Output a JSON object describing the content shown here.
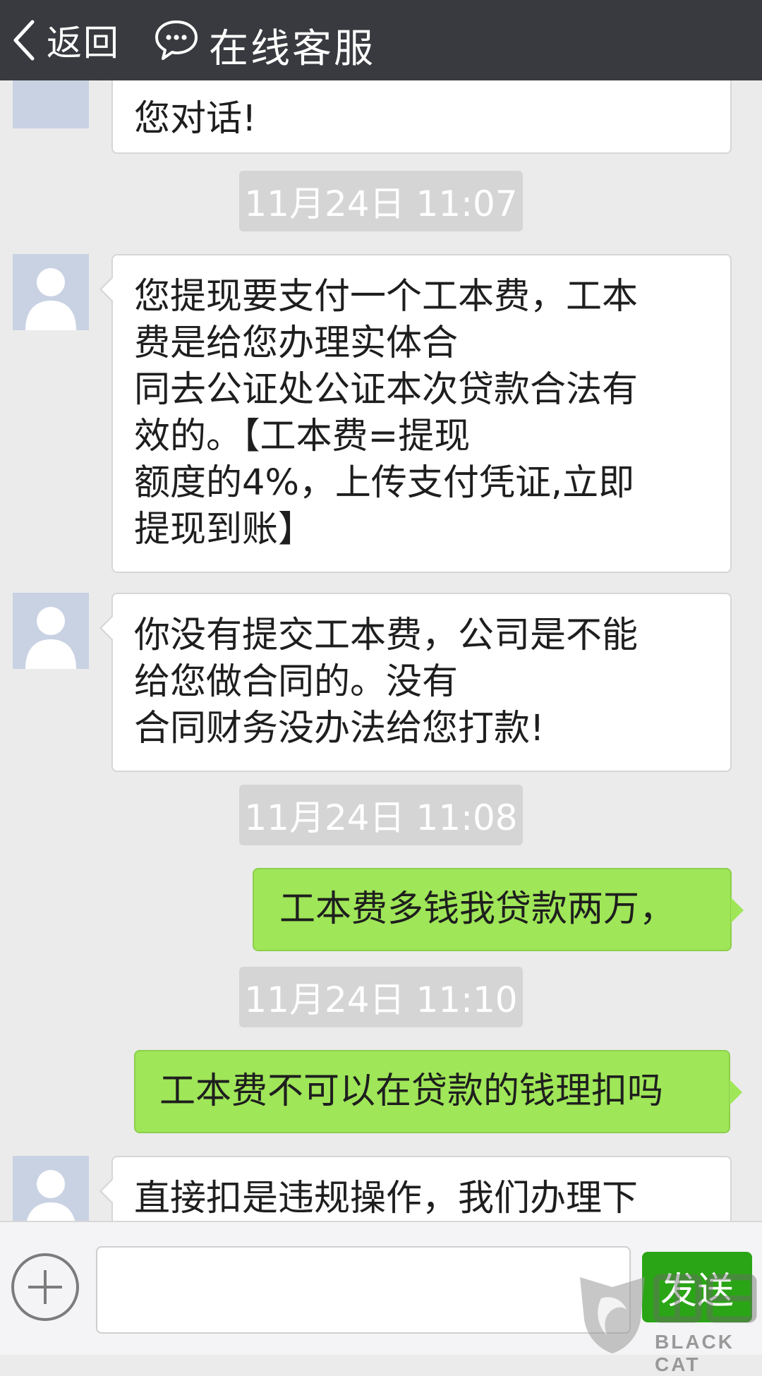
{
  "header": {
    "back_label": "返回",
    "title": "在线客服",
    "bg_color": "#393a3f"
  },
  "messages": [
    {
      "type": "incoming",
      "lines": [
        "您对话!"
      ]
    },
    {
      "type": "timestamp",
      "text": "11月24日 11:07"
    },
    {
      "type": "incoming",
      "lines": [
        "您提现要支付一个工本费，工本",
        "费是给您办理实体合",
        "同去公证处公证本次贷款合法有",
        "效的。【工本费=提现",
        "额度的4%，上传支付凭证,立即",
        "提现到账】"
      ]
    },
    {
      "type": "incoming",
      "lines": [
        "你没有提交工本费，公司是不能",
        "给您做合同的。没有",
        "合同财务没办法给您打款!"
      ]
    },
    {
      "type": "timestamp",
      "text": "11月24日 11:08"
    },
    {
      "type": "outgoing",
      "text": "工本费多钱我贷款两万，"
    },
    {
      "type": "timestamp",
      "text": "11月24日 11:10"
    },
    {
      "type": "outgoing",
      "text": "工本费不可以在贷款的钱理扣吗"
    },
    {
      "type": "incoming",
      "lines": [
        "直接扣是违规操作，我们办理下"
      ]
    }
  ],
  "input_bar": {
    "placeholder": "",
    "send_label": "发送"
  },
  "watermark": {
    "text": "BLACK CAT",
    "icon": "black-cat-logo"
  },
  "colors": {
    "outgoing_bubble": "#9fe658",
    "send_button": "#2aa515",
    "background": "#ebebeb"
  }
}
